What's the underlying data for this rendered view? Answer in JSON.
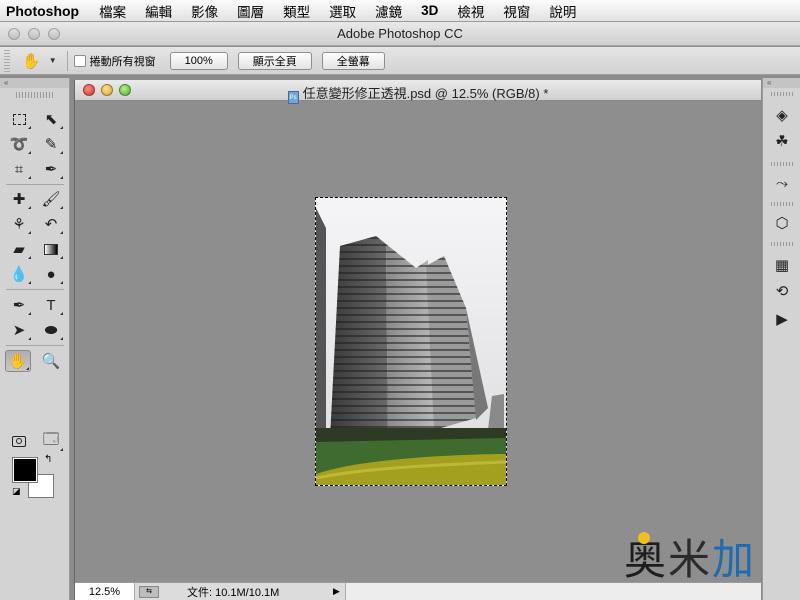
{
  "menubar": {
    "app": "Photoshop",
    "items": [
      "檔案",
      "編輯",
      "影像",
      "圖層",
      "類型",
      "選取",
      "濾鏡",
      "3D",
      "檢視",
      "視窗",
      "說明"
    ]
  },
  "window": {
    "title": "Adobe Photoshop CC"
  },
  "options": {
    "scroll_all_label": "捲動所有視窗",
    "zoom_button": "100%",
    "fit_screen_button": "顯示全頁",
    "fill_screen_button": "全螢幕"
  },
  "document": {
    "title": "任意變形修正透視.psd @ 12.5% (RGB/8) *",
    "psd_badge": "Ps"
  },
  "status": {
    "zoom": "12.5%",
    "info": "文件: 10.1M/10.1M"
  },
  "watermark": {
    "text1": "奥",
    "text2": "米",
    "text3": "加"
  },
  "colors": {
    "foreground": "#000000",
    "background": "#ffffff"
  }
}
